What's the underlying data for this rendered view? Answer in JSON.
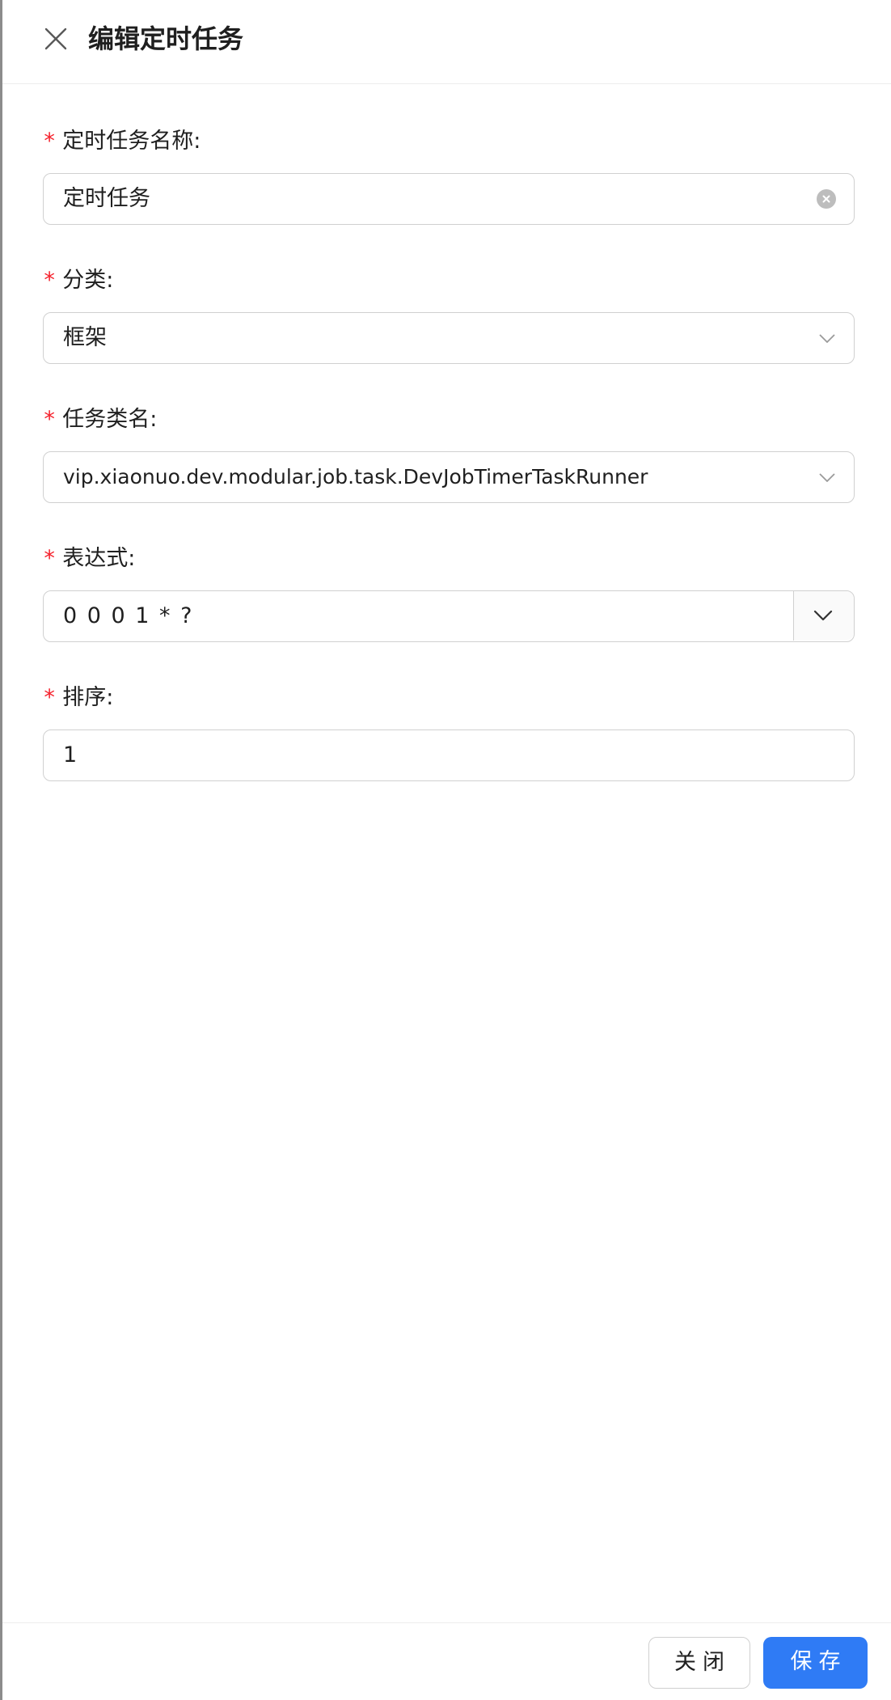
{
  "header": {
    "title": "编辑定时任务",
    "close_icon": "close-icon"
  },
  "form": {
    "name": {
      "required_mark": "*",
      "label": "定时任务名称:",
      "value": "定时任务"
    },
    "category": {
      "required_mark": "*",
      "label": "分类:",
      "value": "框架"
    },
    "action_class": {
      "required_mark": "*",
      "label": "任务类名:",
      "value": "vip.xiaonuo.dev.modular.job.task.DevJobTimerTaskRunner"
    },
    "cron": {
      "required_mark": "*",
      "label": "表达式:",
      "value": "0 0 0 1 * ?"
    },
    "sort": {
      "required_mark": "*",
      "label": "排序:",
      "value": "1"
    }
  },
  "footer": {
    "close_label": "关闭",
    "save_label": "保存"
  },
  "colors": {
    "primary": "#2f7bf5",
    "required": "#f5222d",
    "border": "#d0d0d0"
  }
}
